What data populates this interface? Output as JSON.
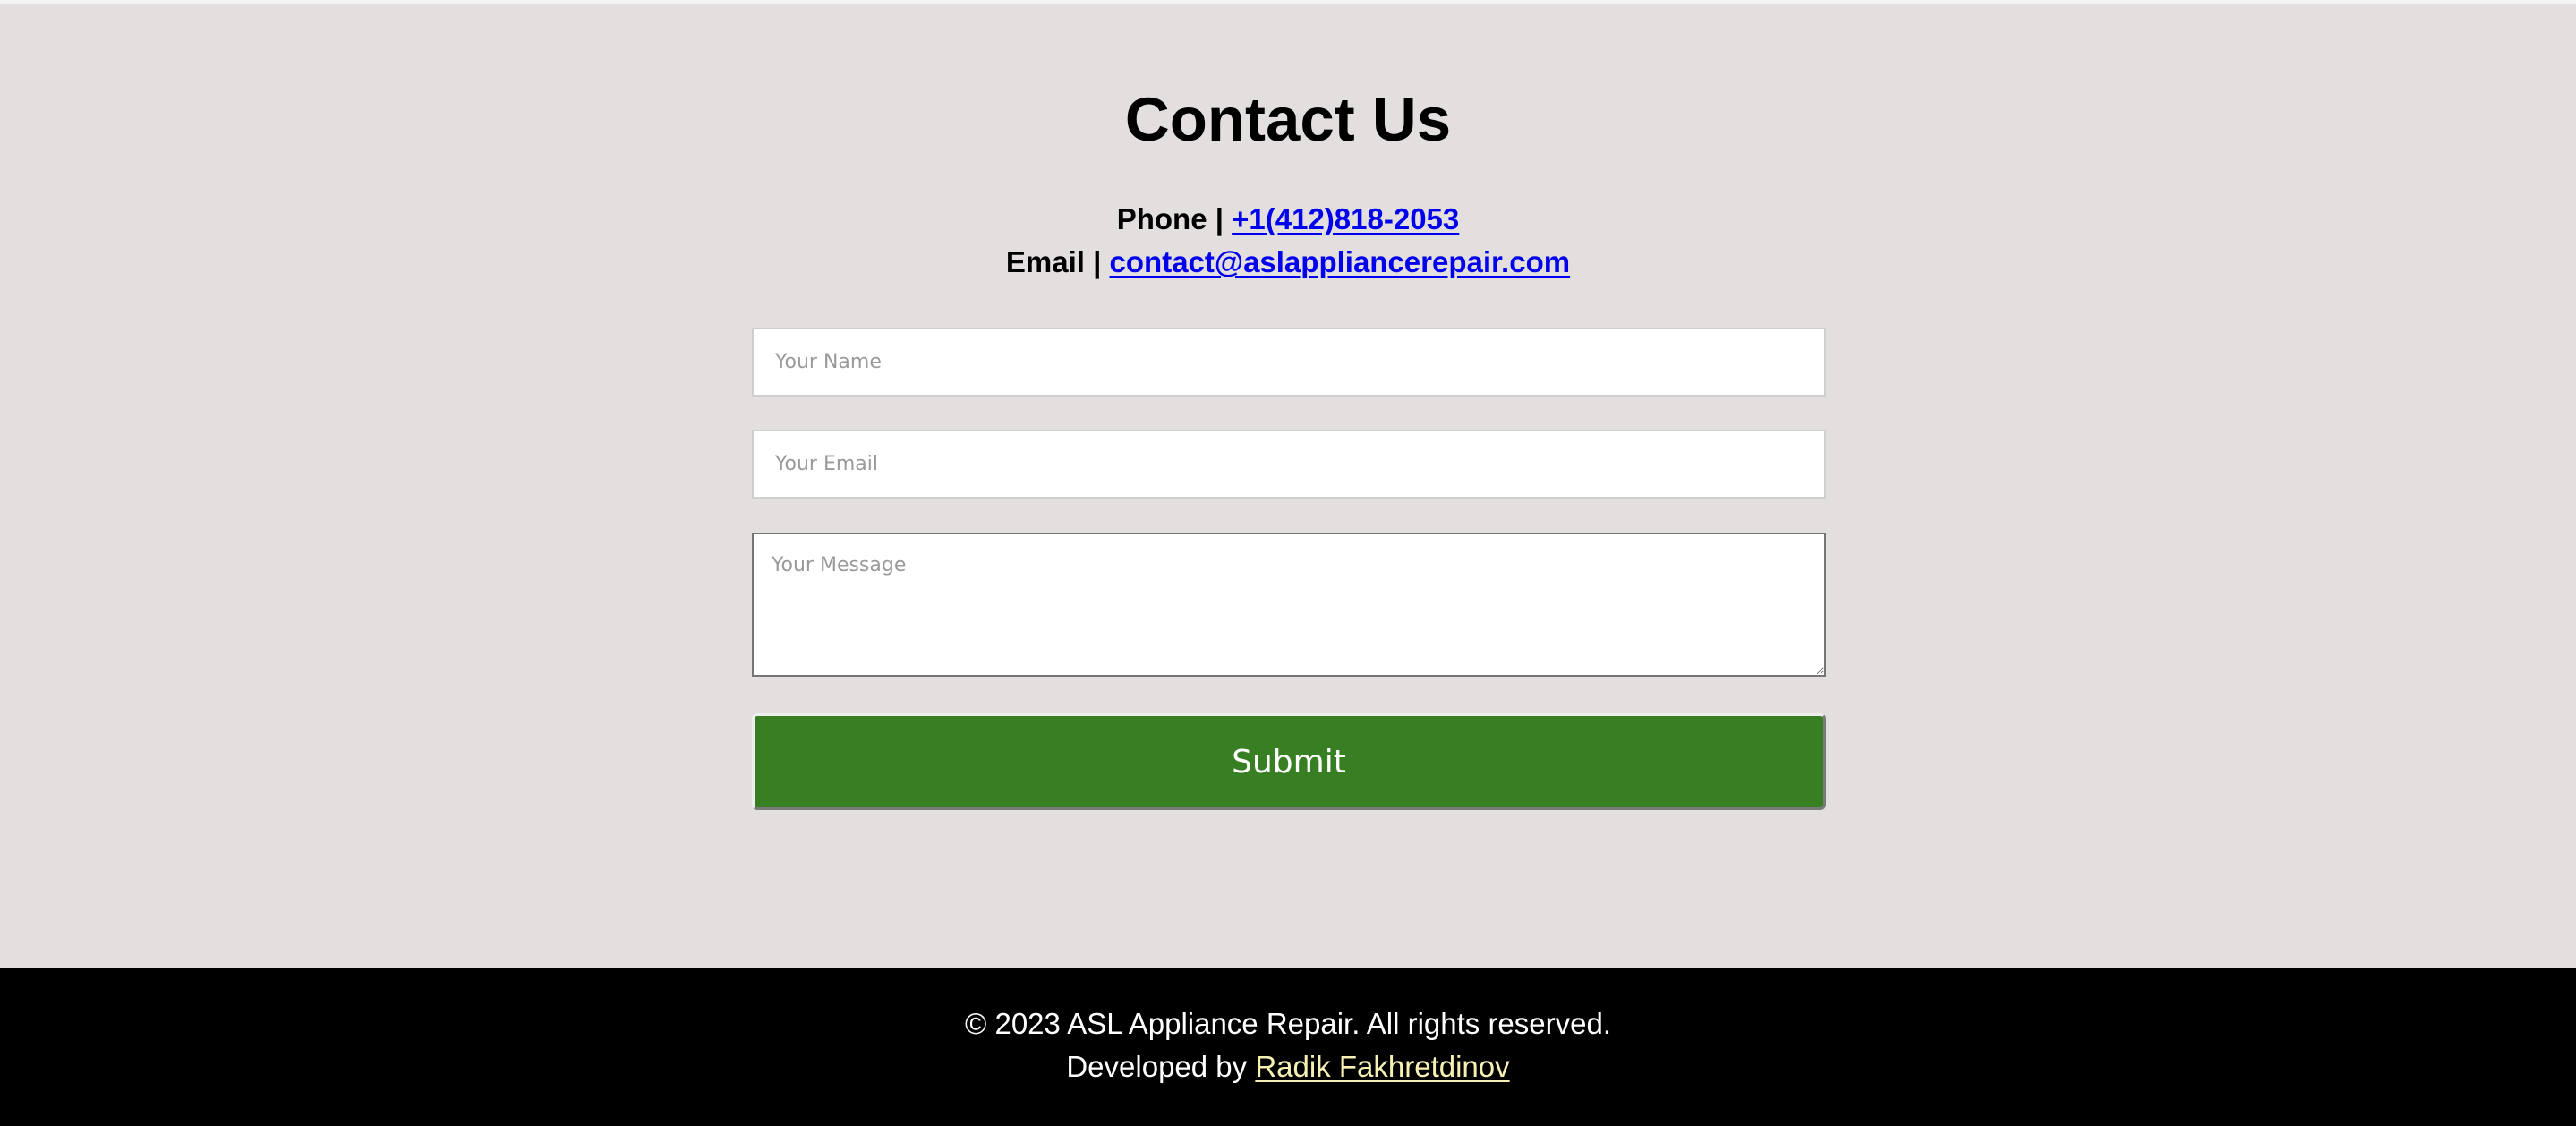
{
  "contact": {
    "title": "Contact Us",
    "phone_label": "Phone | ",
    "phone_value": "+1(412)818-2053",
    "email_label": "Email | ",
    "email_value": "contact@aslappliancerepair.com"
  },
  "form": {
    "name_placeholder": "Your Name",
    "email_placeholder": "Your Email",
    "message_placeholder": "Your Message",
    "submit_label": "Submit"
  },
  "footer": {
    "copyright": "© 2023 ASL Appliance Repair. All rights reserved.",
    "developed_by_label": "Developed by ",
    "developer_name": "Radik Fakhretdinov"
  },
  "colors": {
    "page_background": "#e2dfde",
    "submit_button": "#387e23",
    "link": "#0000ee",
    "footer_background": "#000000",
    "footer_link": "#f6f0b3"
  }
}
